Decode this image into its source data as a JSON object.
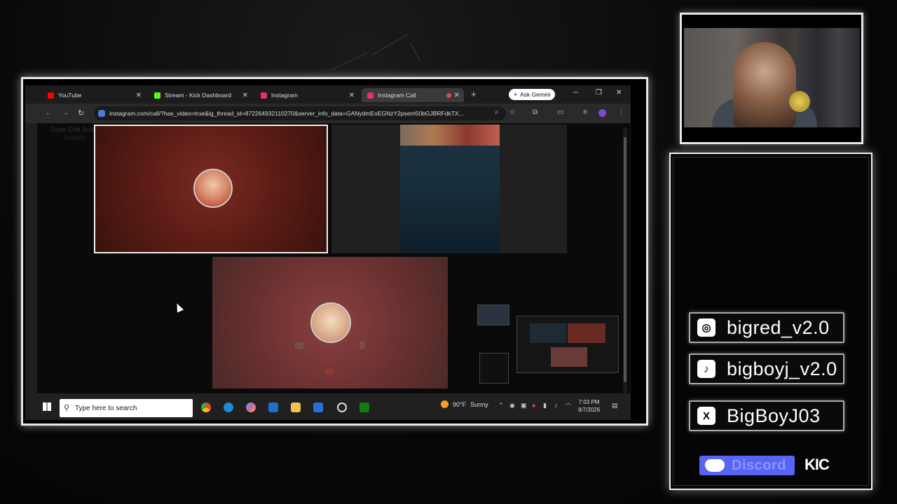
{
  "browser": {
    "tabs": [
      {
        "label": "YouTube",
        "color": "#ff0000"
      },
      {
        "label": "Stream - Kick Dashboard",
        "color": "#53fc18"
      },
      {
        "label": "Instagram",
        "color": "#e1306c"
      },
      {
        "label": "Instagram Call",
        "color": "#e1306c"
      }
    ],
    "new_tab": "+",
    "ask_gemini": "Ask Gemini",
    "url": "instagram.com/call/?has_video=true&ig_thread_id=872264932110270&server_info_data=GANydmEoEGNzY2psem50bGJBRFdkTX..."
  },
  "call": {
    "group_name": "Dude Chill Just Chill",
    "group_people": "4 people"
  },
  "taskbar": {
    "search_placeholder": "Type here to search",
    "weather_temp": "90°F",
    "weather_text": "Sunny",
    "time": "7:03 PM",
    "date": "8/7/2026"
  },
  "socials": {
    "instagram": "bigred_v2.0",
    "tiktok": "bigboyj_v2.0",
    "x": "BigBoyJ03",
    "discord": "Discord",
    "kick": "KIC"
  }
}
